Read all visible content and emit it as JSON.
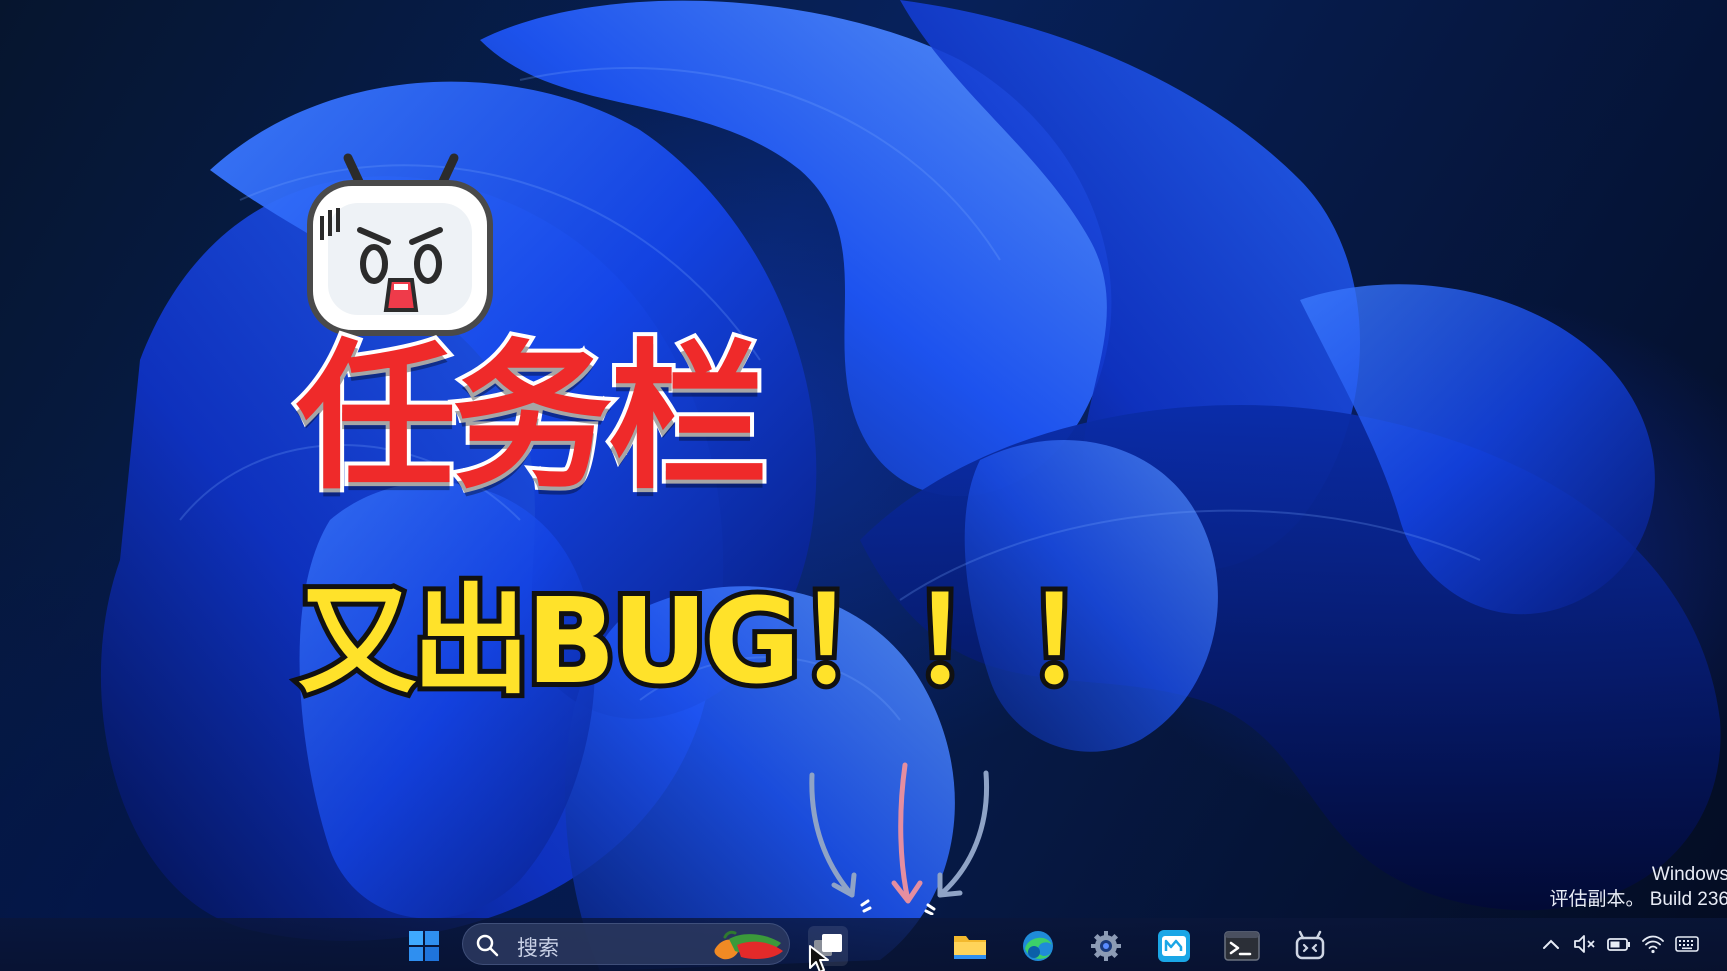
{
  "overlay": {
    "title": "任务栏",
    "subtitle": "又出BUG！！！"
  },
  "watermark": {
    "line1": "Windows",
    "line2": "评估副本。 Build 236"
  },
  "taskbar": {
    "search_placeholder": "搜索",
    "pinned_apps": [
      "start-icon",
      "task-view-icon",
      "file-explorer-icon",
      "edge-browser-icon",
      "settings-icon",
      "app-icon",
      "terminal-icon",
      "dev-home-icon"
    ],
    "tray_icons": [
      "chevron-up-icon",
      "volume-muted-icon",
      "battery-icon",
      "wifi-icon",
      "keyboard-icon"
    ]
  },
  "colors": {
    "title_red": "#ef2a2a",
    "subtitle_yellow": "#ffe22a",
    "accent_blue": "#1f5cff"
  }
}
